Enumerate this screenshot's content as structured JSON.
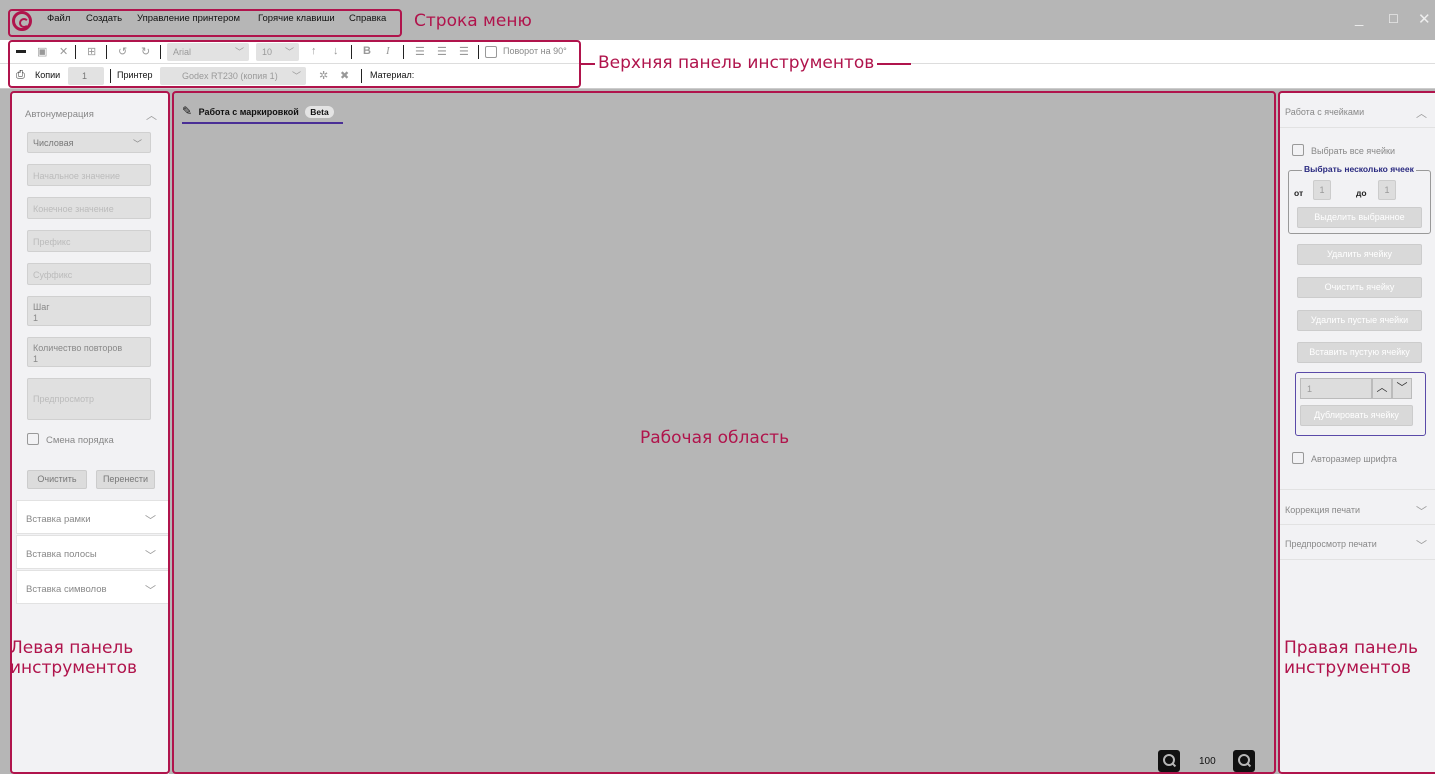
{
  "menu": {
    "items": [
      "Файл",
      "Создать",
      "Управление принтером",
      "Горячие клавиши",
      "Справка"
    ]
  },
  "toolbar": {
    "font_name": "Arial",
    "font_size": "10",
    "bold": "B",
    "italic": "I",
    "rotate_label": "Поворот на 90°",
    "copies_label": "Копии",
    "copies_value": "1",
    "printer_label": "Принтер",
    "printer_value": "Godex RT230 (копия 1)",
    "material_label": "Материал:"
  },
  "left_panel": {
    "autonumber_header": "Автонумерация",
    "type_select": "Числовая",
    "start_placeholder": "Начальное значение",
    "end_placeholder": "Конечное значение",
    "prefix_placeholder": "Префикс",
    "suffix_placeholder": "Суффикс",
    "step_label": "Шаг",
    "step_value": "1",
    "repeat_label": "Количество повторов",
    "repeat_value": "1",
    "preview_placeholder": "Предпросмотр",
    "order_change": "Смена порядка",
    "clear_btn": "Очистить",
    "transfer_btn": "Перенести",
    "sections": [
      "Вставка рамки",
      "Вставка полосы",
      "Вставка символов"
    ]
  },
  "workspace": {
    "tab_label": "Работа с маркировкой",
    "tab_badge": "Beta",
    "zoom_value": "100"
  },
  "right_panel": {
    "cells_header": "Работа с ячейками",
    "select_all": "Выбрать все ячейки",
    "multi_legend": "Выбрать несколько ячеек",
    "from_label": "от",
    "from_value": "1",
    "to_label": "до",
    "to_value": "1",
    "highlight_btn": "Выделить выбранное",
    "delete_cell": "Удалить ячейку",
    "clear_cell": "Очистить ячейку",
    "delete_empty": "Удалить пустые ячейки",
    "insert_empty": "Вставить пустую ячейку",
    "dup_value": "1",
    "duplicate_btn": "Дублировать ячейку",
    "autosize": "Авторазмер шрифта",
    "print_correction": "Коррекция печати",
    "print_preview": "Предпросмотр печати"
  },
  "annotations": {
    "menu_bar": "Строка меню",
    "top_toolbar": "Верхняя панель инструментов",
    "workspace": "Рабочая область",
    "left_panel": "Левая панель инструментов",
    "right_panel": "Правая панель инструментов"
  },
  "colors": {
    "annotation": "#b0144c",
    "accent": "#4a2f96",
    "workspace_bg": "#b6b6b6"
  }
}
